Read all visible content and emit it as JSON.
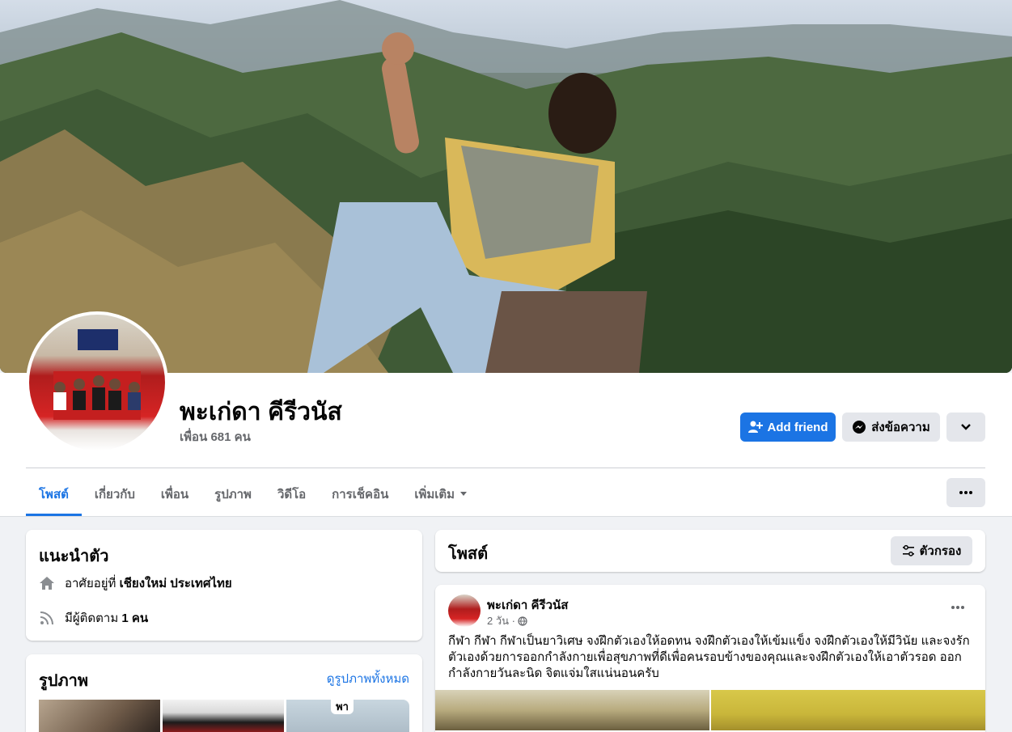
{
  "profile": {
    "name": "พะเก่ดา คีรีวนัส",
    "friends_count": "เพื่อน 681 คน"
  },
  "actions": {
    "add_friend": "Add friend",
    "message": "ส่งข้อความ"
  },
  "tabs": [
    {
      "label": "โพสต์",
      "active": true
    },
    {
      "label": "เกี่ยวกับ"
    },
    {
      "label": "เพื่อน"
    },
    {
      "label": "รูปภาพ"
    },
    {
      "label": "วิดีโอ"
    },
    {
      "label": "การเช็คอิน"
    },
    {
      "label": "เพิ่มเติม"
    }
  ],
  "intro": {
    "title": "แนะนำตัว",
    "lives_prefix": "อาศัยอยู่ที่",
    "lives_value": "เชียงใหม่ ประเทศไทย",
    "followers_prefix": "มีผู้ติดตาม",
    "followers_value": "1 คน"
  },
  "photos": {
    "title": "รูปภาพ",
    "see_all": "ดูรูปภาพทั้งหมด",
    "third_photo_text": "พา"
  },
  "posts_header": {
    "title": "โพสต์",
    "filter": "ตัวกรอง"
  },
  "post": {
    "author": "พะเก่ดา คีรีวนัส",
    "time": "2 วัน ·",
    "text": "กีฬา กีฬา กีฬาเป็นยาวิเศษ จงฝึกตัวเองให้อดทน จงฝึกตัวเองให้เข้มแข็ง จงฝึกตัวเองให้มีวินัย และจงรักตัวเองด้วยการออกกำลังกายเพื่อสุขภาพที่ดีเพื่อคนรอบข้างของคุณและจงฝึกตัวเองให้เอาตัวรอด ออกกำลังกายวันละนิด จิตแจ่มใสแน่นอนครับ"
  },
  "icons": {
    "add_friend": "person-plus-icon",
    "message": "messenger-icon",
    "dropdown": "chevron-down-icon",
    "more": "ellipsis-icon",
    "home": "home-icon",
    "rss": "rss-icon",
    "filter": "sliders-icon",
    "globe": "globe-icon"
  },
  "colors": {
    "accent": "#1b74e4",
    "background": "#f0f2f5"
  }
}
